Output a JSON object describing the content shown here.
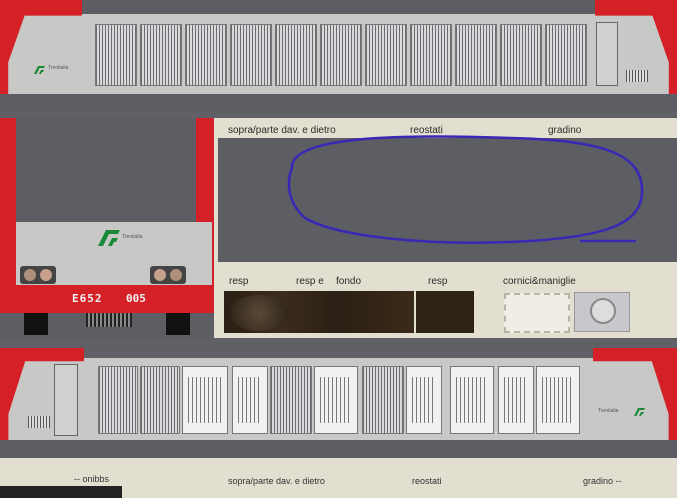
{
  "labels": {
    "top_left_strip": "sopra/parte dav. e dietro",
    "top_mid_strip": "reostati",
    "top_right_strip": "gradino",
    "resp1": "resp",
    "resp2": "resp e",
    "fondo": "fondo",
    "resp3": "resp",
    "cornici": "cornici&maniglie",
    "loco_number": "E652",
    "loco_suffix": "005",
    "bottom_left": "-- onibbs",
    "bottom_mid1": "sopra/parte dav. e dietro",
    "bottom_mid2": "reostati",
    "bottom_right": "gradino --",
    "brand_small": "Trenitalia",
    "brand_small2": "Trenitalia",
    "brand_small3": "Trenitalia"
  },
  "colors": {
    "red": "#d42026",
    "body_grey": "#5c5e63",
    "panel": "#c9c9c7",
    "cream": "#e6e2d4",
    "annotation": "#3b27b6"
  }
}
